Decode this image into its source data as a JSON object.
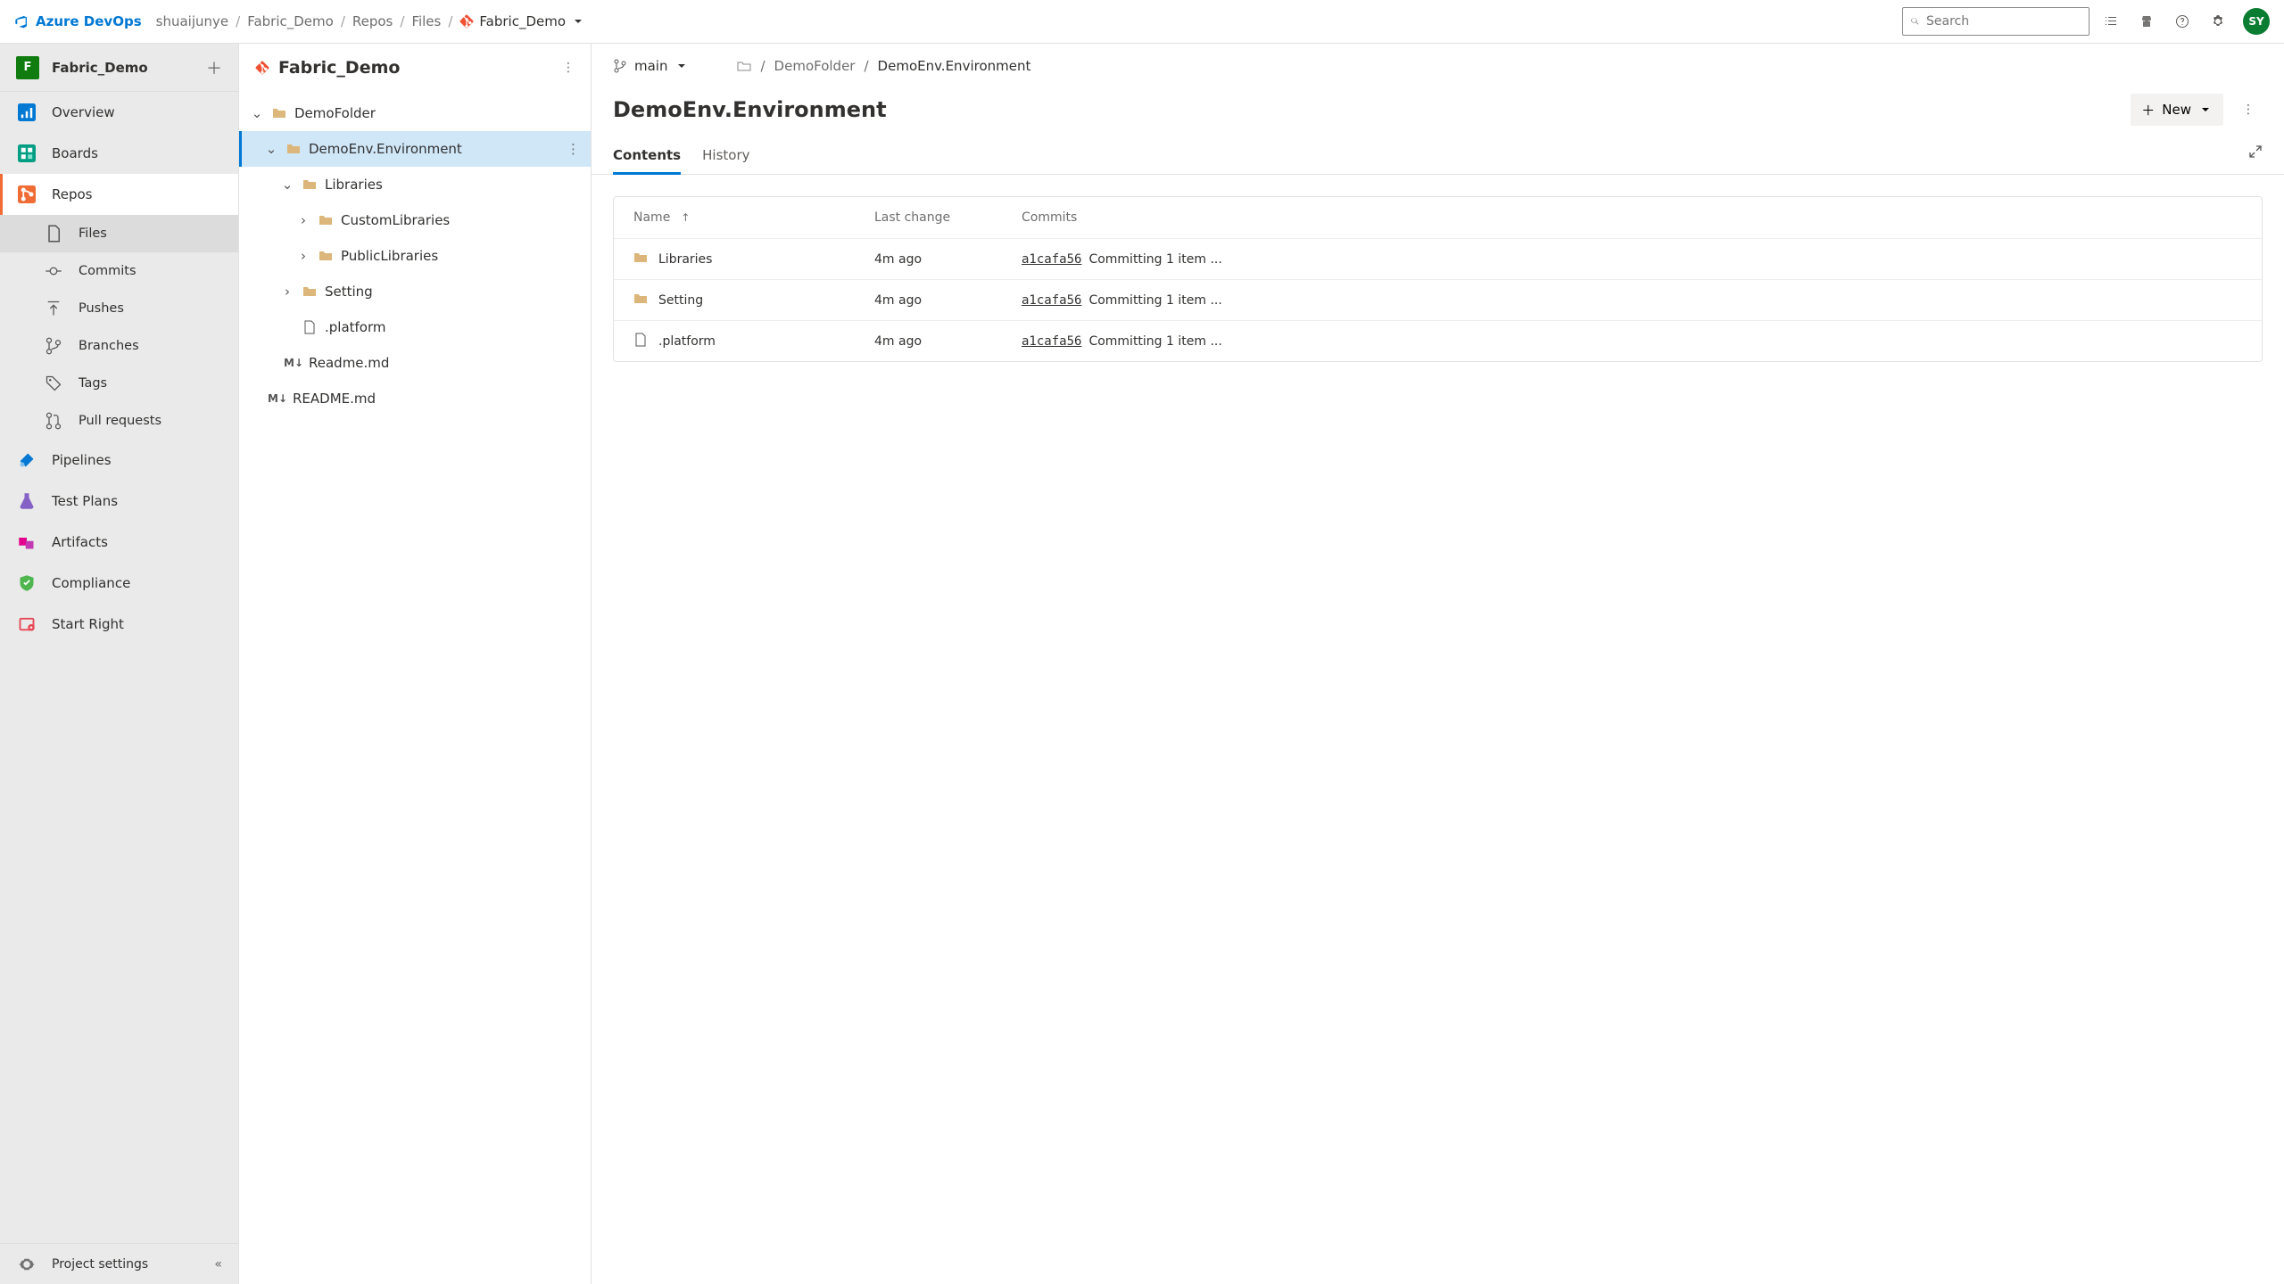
{
  "brand": "Azure DevOps",
  "breadcrumbs": {
    "org": "shuaijunye",
    "project": "Fabric_Demo",
    "section": "Repos",
    "sub": "Files",
    "repo": "Fabric_Demo"
  },
  "search": {
    "placeholder": "Search"
  },
  "user": {
    "initials": "SY"
  },
  "project": {
    "letter": "F",
    "name": "Fabric_Demo"
  },
  "nav": {
    "overview": "Overview",
    "boards": "Boards",
    "repos": "Repos",
    "files": "Files",
    "commits": "Commits",
    "pushes": "Pushes",
    "branches": "Branches",
    "tags": "Tags",
    "pulls": "Pull requests",
    "pipelines": "Pipelines",
    "testplans": "Test Plans",
    "artifacts": "Artifacts",
    "compliance": "Compliance",
    "startright": "Start Right",
    "settings": "Project settings"
  },
  "tree": {
    "repo": "Fabric_Demo",
    "n0": "DemoFolder",
    "n1": "DemoEnv.Environment",
    "n2": "Libraries",
    "n3": "CustomLibraries",
    "n4": "PublicLibraries",
    "n5": "Setting",
    "n6": ".platform",
    "n7": "Readme.md",
    "n8": "README.md"
  },
  "branch": "main",
  "path": {
    "a": "DemoFolder",
    "b": "DemoEnv.Environment"
  },
  "title": "DemoEnv.Environment",
  "new_label": "New",
  "tabs": {
    "contents": "Contents",
    "history": "History"
  },
  "columns": {
    "name": "Name",
    "last": "Last change",
    "commits": "Commits"
  },
  "rows": [
    {
      "icon": "folder",
      "name": "Libraries",
      "last": "4m ago",
      "hash": "a1cafa56",
      "msg": "Committing 1 item ..."
    },
    {
      "icon": "folder",
      "name": "Setting",
      "last": "4m ago",
      "hash": "a1cafa56",
      "msg": "Committing 1 item ..."
    },
    {
      "icon": "file",
      "name": ".platform",
      "last": "4m ago",
      "hash": "a1cafa56",
      "msg": "Committing 1 item ..."
    }
  ]
}
